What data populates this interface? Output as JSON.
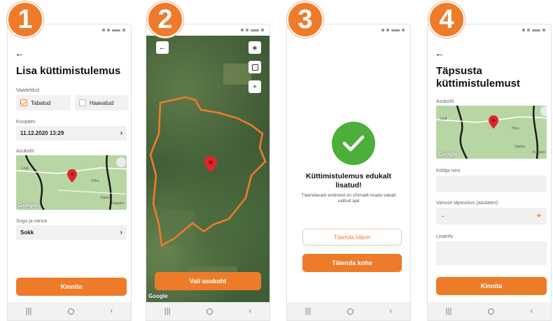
{
  "steps": [
    "1",
    "2",
    "3",
    "4"
  ],
  "screen1": {
    "title": "Lisa küttimistulemus",
    "observed_label": "Vaadeldud",
    "captured_label": "Tabatud",
    "captured_checked": true,
    "wounded_label": "Haavatud",
    "wounded_checked": false,
    "date_label": "Kuupäev",
    "date_value": "11.12.2020 13:29",
    "location_label": "Asukoht",
    "sex_age_label": "Sugu ja vanus",
    "sex_age_value": "Sokk",
    "submit_label": "Kinnita"
  },
  "screen2": {
    "select_location_label": "Vali asukoht",
    "layers_icon": "layers-icon",
    "square_icon": "square-icon",
    "locate_icon": "locate-icon"
  },
  "screen3": {
    "title": "Küttimistulemus edukalt lisatud!",
    "subtitle": "Täiendavaid andmeid on võimalik lisada vabalt valitud ajal",
    "later_label": "Täienda hiljem",
    "now_label": "Täienda kohe"
  },
  "screen4": {
    "title": "Täpsusta küttimistulemust",
    "location_label": "Asukoht",
    "hunter_label": "Küttija nimi",
    "age_label": "Vanuse täpsustus (aastates)",
    "minus": "-",
    "plus": "+",
    "info_label": "Lisainfo",
    "submit_label": "Kinnita"
  },
  "map": {
    "google": "Google",
    "places": [
      "Linå",
      "Põru",
      "Kuigatsi",
      "Vastsa"
    ]
  },
  "colors": {
    "accent": "#ee7b2a",
    "success": "#4caf3b"
  }
}
